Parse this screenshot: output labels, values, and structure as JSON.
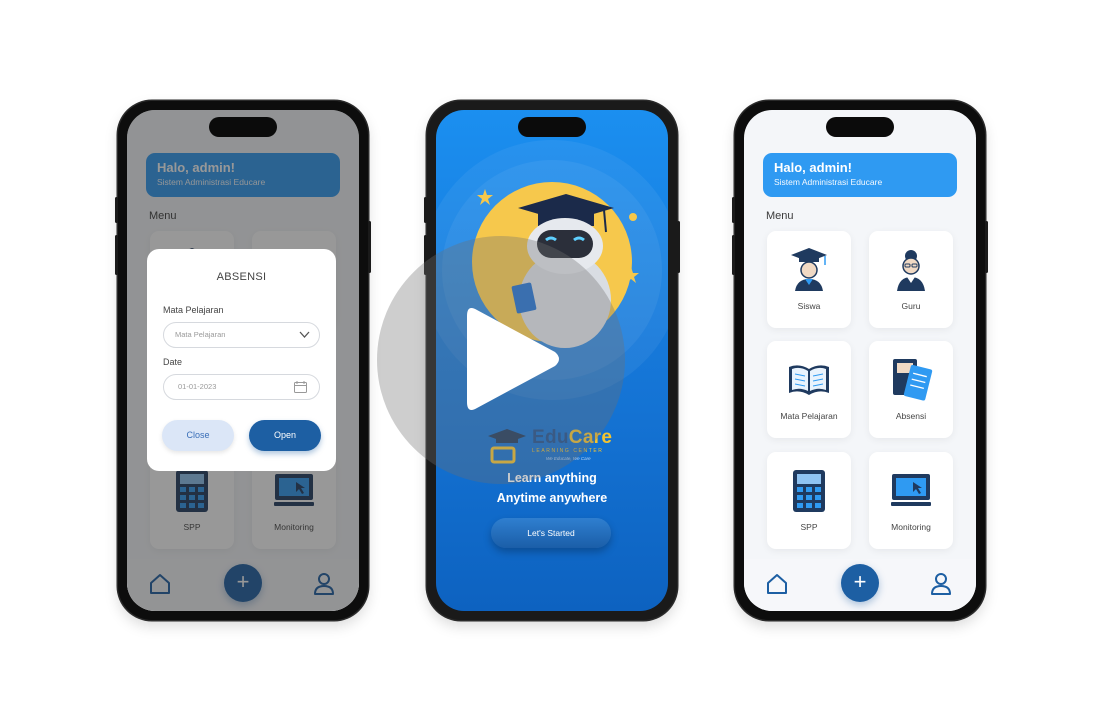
{
  "dashboard": {
    "greeting_title": "Halo, admin!",
    "greeting_subtitle": "Sistem Administrasi Educare",
    "menu_label": "Menu",
    "tiles": [
      {
        "label": "Siswa",
        "icon": "student-graduate-icon"
      },
      {
        "label": "Guru",
        "icon": "teacher-icon"
      },
      {
        "label": "Mata Pelajaran",
        "icon": "open-book-icon"
      },
      {
        "label": "Absensi",
        "icon": "attendance-book-icon"
      },
      {
        "label": "SPP",
        "icon": "calculator-icon"
      },
      {
        "label": "Monitoring",
        "icon": "monitor-icon"
      }
    ],
    "nav": {
      "home_icon": "home-icon",
      "add_icon": "plus-icon",
      "add_symbol": "+",
      "profile_icon": "user-icon"
    }
  },
  "dialog": {
    "title": "ABSENSI",
    "subject_label": "Mata Pelajaran",
    "subject_placeholder": "Mata Pelajaran",
    "date_label": "Date",
    "date_value": "01-01-2023",
    "close_label": "Close",
    "open_label": "Open"
  },
  "splash": {
    "logo_edu": "Edu",
    "logo_care": "Care",
    "logo_subtitle": "LEARNING CENTER",
    "logo_motto": "We Educate, We Care",
    "tagline_1": "Learn anything",
    "tagline_2": "Anytime anywhere",
    "start_label": "Let's Started"
  },
  "colors": {
    "primary_blue": "#2f9af2",
    "dark_blue": "#1d5fa3",
    "splash_blue": "#1b8ff0",
    "moon_yellow": "#f6c84c",
    "accent_yellow": "#f4c430"
  }
}
